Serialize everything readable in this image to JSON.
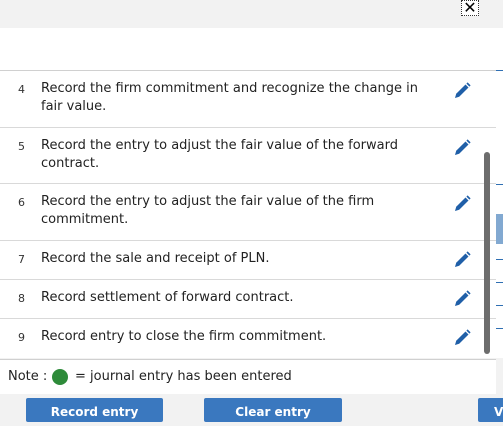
{
  "dialog": {
    "close_glyph": "✕"
  },
  "transactions": [
    {
      "num": "4",
      "text": "Record the firm commitment and recognize the change in fair value."
    },
    {
      "num": "5",
      "text": "Record the entry to adjust the fair value of the forward contract."
    },
    {
      "num": "6",
      "text": "Record the entry to adjust the fair value of the firm commitment."
    },
    {
      "num": "7",
      "text": "Record the sale and receipt of PLN."
    },
    {
      "num": "8",
      "text": "Record settlement of forward contract."
    },
    {
      "num": "9",
      "text": "Record entry to close the firm commitment."
    }
  ],
  "note": {
    "label": "Note :",
    "text": "= journal entry has been entered",
    "dot_color": "#2e8b3a"
  },
  "buttons": {
    "record": "Record entry",
    "clear": "Clear entry",
    "view": "V"
  },
  "colors": {
    "accent": "#3a78bf",
    "edit_icon": "#1f5fa8"
  },
  "icons": {
    "row_action": "pencil-edit-icon",
    "close": "close-icon"
  }
}
